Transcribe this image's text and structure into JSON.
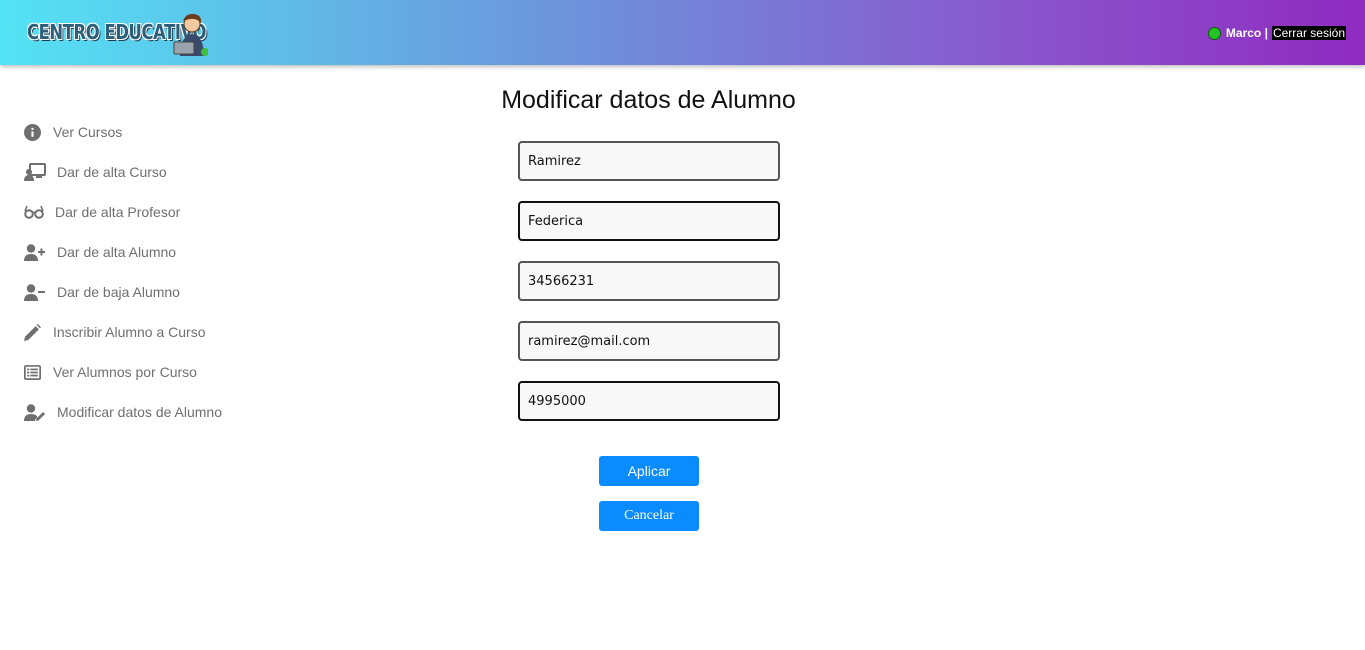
{
  "header": {
    "logo_text": "CENTRO EDUCATIVO",
    "user_name": "Marco |",
    "logout_label": "Cerrar sesión",
    "status_color": "#22c322"
  },
  "sidebar": {
    "items": [
      {
        "label": "Ver Cursos",
        "icon": "info-circle-icon"
      },
      {
        "label": "Dar de alta Curso",
        "icon": "chalkboard-teacher-icon"
      },
      {
        "label": "Dar de alta Profesor",
        "icon": "glasses-icon"
      },
      {
        "label": "Dar de alta Alumno",
        "icon": "user-plus-icon"
      },
      {
        "label": "Dar de baja Alumno",
        "icon": "user-minus-icon"
      },
      {
        "label": "Inscribir Alumno a Curso",
        "icon": "pencil-icon"
      },
      {
        "label": "Ver Alumnos por Curso",
        "icon": "list-icon"
      },
      {
        "label": "Modificar datos de Alumno",
        "icon": "user-edit-icon"
      }
    ]
  },
  "main": {
    "title": "Modificar datos de Alumno",
    "fields": {
      "apellido": "Ramirez",
      "nombre": "Federica",
      "dni": "34566231",
      "email": "ramirez@mail.com",
      "telefono": "4995000"
    },
    "apply_label": "Aplicar",
    "cancel_label": "Cancelar"
  },
  "colors": {
    "accent_button": "#0a8cff",
    "header_gradient_start": "#53e3f4",
    "header_gradient_end": "#8f2bc0"
  }
}
